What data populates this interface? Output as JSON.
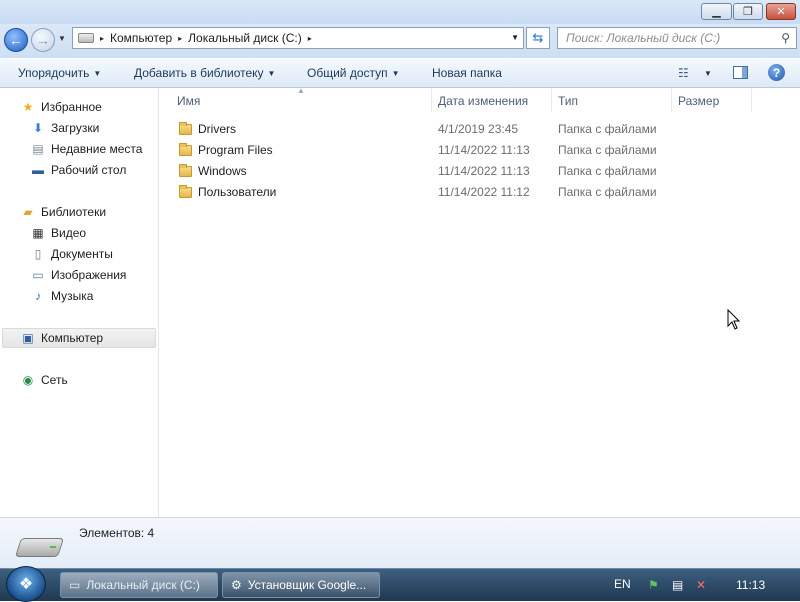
{
  "titlebar": {
    "minimize": "▁",
    "maximize": "❐",
    "close": "✕"
  },
  "address": {
    "root_arrow": "▸",
    "crumbs": [
      "Компьютер",
      "Локальный диск (C:)"
    ],
    "sep": "▸",
    "search_placeholder": "Поиск: Локальный диск (C:)"
  },
  "toolbar": {
    "organize": "Упорядочить",
    "add_to_library": "Добавить в библиотеку",
    "share": "Общий доступ",
    "new_folder": "Новая папка",
    "dropdown_arrow": "▼",
    "help": "?"
  },
  "navigation": {
    "favorites": "Избранное",
    "downloads": "Загрузки",
    "recent_places": "Недавние места",
    "desktop": "Рабочий стол",
    "libraries": "Библиотеки",
    "video": "Видео",
    "documents": "Документы",
    "pictures": "Изображения",
    "music": "Музыка",
    "computer": "Компьютер",
    "network": "Сеть"
  },
  "columns": {
    "name": "Имя",
    "date": "Дата изменения",
    "type": "Тип",
    "size": "Размер"
  },
  "files": [
    {
      "name": "Drivers",
      "date": "4/1/2019 23:45",
      "type": "Папка с файлами"
    },
    {
      "name": "Program Files",
      "date": "11/14/2022 11:13",
      "type": "Папка с файлами"
    },
    {
      "name": "Windows",
      "date": "11/14/2022 11:13",
      "type": "Папка с файлами"
    },
    {
      "name": "Пользователи",
      "date": "11/14/2022 11:12",
      "type": "Папка с файлами"
    }
  ],
  "details": {
    "item_count": "Элементов: 4"
  },
  "taskbar": {
    "explorer_task": "Локальный диск (C:)",
    "installer_task": "Установщик Google...",
    "language": "EN",
    "clock": "11:13"
  }
}
